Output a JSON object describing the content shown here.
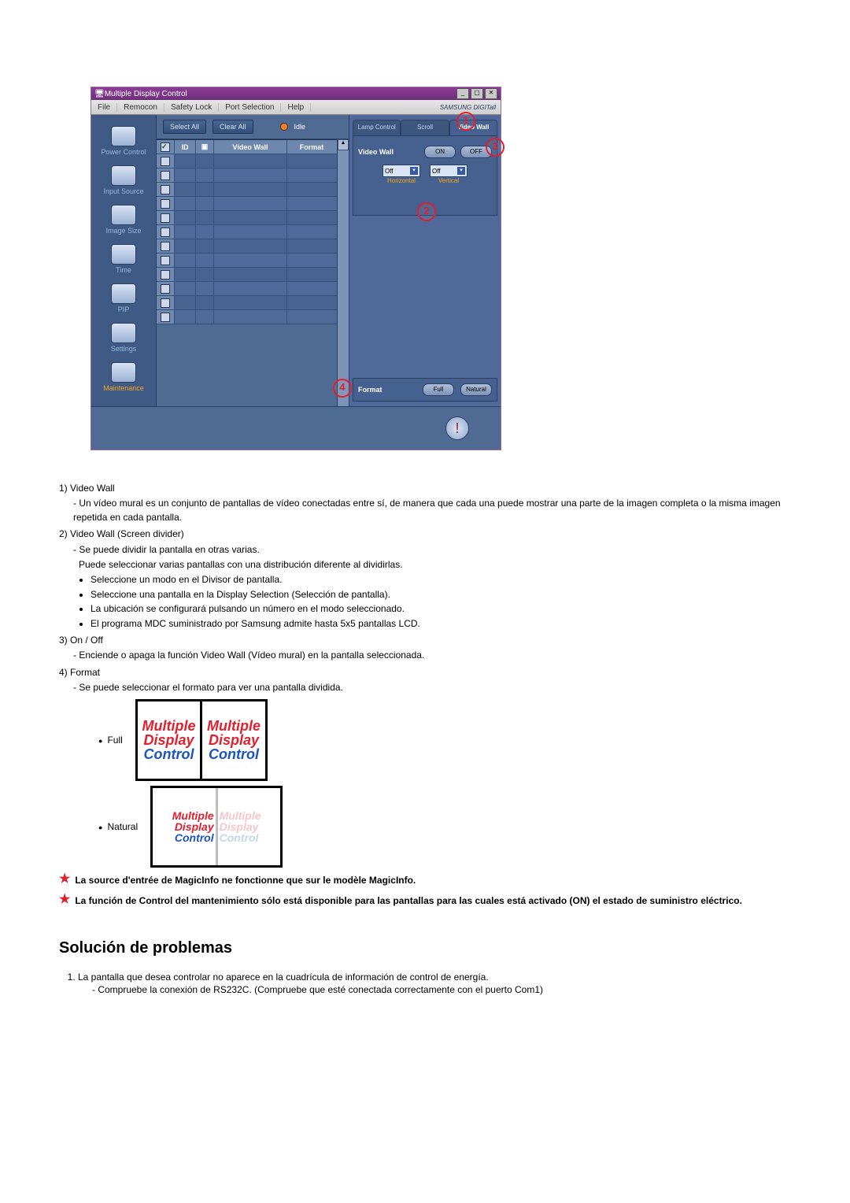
{
  "window": {
    "title": "Multiple Display Control",
    "menubar": [
      "File",
      "Remocon",
      "Safety Lock",
      "Port Selection",
      "Help"
    ],
    "brand": "SAMSUNG DIGITall"
  },
  "toolbar": {
    "select_all": "Select All",
    "clear_all": "Clear All",
    "idle": "Idle"
  },
  "nav": [
    {
      "label": "Power Control"
    },
    {
      "label": "Input Source"
    },
    {
      "label": "Image Size"
    },
    {
      "label": "Time"
    },
    {
      "label": "PIP"
    },
    {
      "label": "Settings"
    },
    {
      "label": "Maintenance",
      "active": true
    }
  ],
  "grid": {
    "headers": {
      "chk": "",
      "id": "ID",
      "st": "",
      "vw": "Video Wall",
      "fmt": "Format"
    },
    "row_count": 12
  },
  "right": {
    "tabs": [
      "Lamp Control",
      "Scroll",
      "Video Wall"
    ],
    "active_tab": 2,
    "vw_label": "Video Wall",
    "on": "ON",
    "off": "OFF",
    "h_value": "Off",
    "h_label": "Horizontal",
    "v_value": "Off",
    "v_label": "Vertical",
    "format_label": "Format",
    "full": "Full",
    "natural": "Natural"
  },
  "callouts": [
    "1",
    "2",
    "3",
    "4"
  ],
  "desc": {
    "item1_title": "1)  Video Wall",
    "item1_l1": "- Un vídeo mural es un conjunto de pantallas de vídeo conectadas entre sí, de manera que cada una puede mostrar una parte de la imagen completa o la misma imagen repetida en cada pantalla.",
    "item2_title": "2)  Video Wall (Screen divider)",
    "item2_l1": "- Se puede dividir la pantalla en otras varias.",
    "item2_l2": "Puede seleccionar varias pantallas con una distribución diferente al dividirlas.",
    "item2_bullets": [
      "Seleccione un modo en el Divisor de pantalla.",
      "Seleccione una pantalla en la Display Selection (Selección de pantalla).",
      "La ubicación se configurará pulsando un número en el modo seleccionado.",
      "El programa MDC suministrado por Samsung admite hasta 5x5 pantallas LCD."
    ],
    "item3_title": "3)  On / Off",
    "item3_l1": "- Enciende o apaga la función Video Wall (Vídeo mural) en la pantalla seleccionada.",
    "item4_title": "4)  Format",
    "item4_l1": "- Se puede seleccionar el formato para ver una pantalla dividida.",
    "full_label": "Full",
    "natural_label": "Natural",
    "thumb_text": [
      "Multiple",
      "Display",
      "Control"
    ]
  },
  "notes": {
    "n1": "La source d'entrée de MagicInfo ne fonctionne que sur le modèle MagicInfo.",
    "n2": "La función de Control del mantenimiento sólo está disponible para las pantallas para las cuales está activado (ON) el estado de suministro eléctrico."
  },
  "troubleshoot": {
    "heading": "Solución de problemas",
    "q1": "La pantalla que desea controlar no aparece en la cuadrícula de información de control de energía.",
    "q1_a": "- Compruebe la conexión de RS232C. (Compruebe que esté conectada correctamente con el puerto Com1)"
  }
}
